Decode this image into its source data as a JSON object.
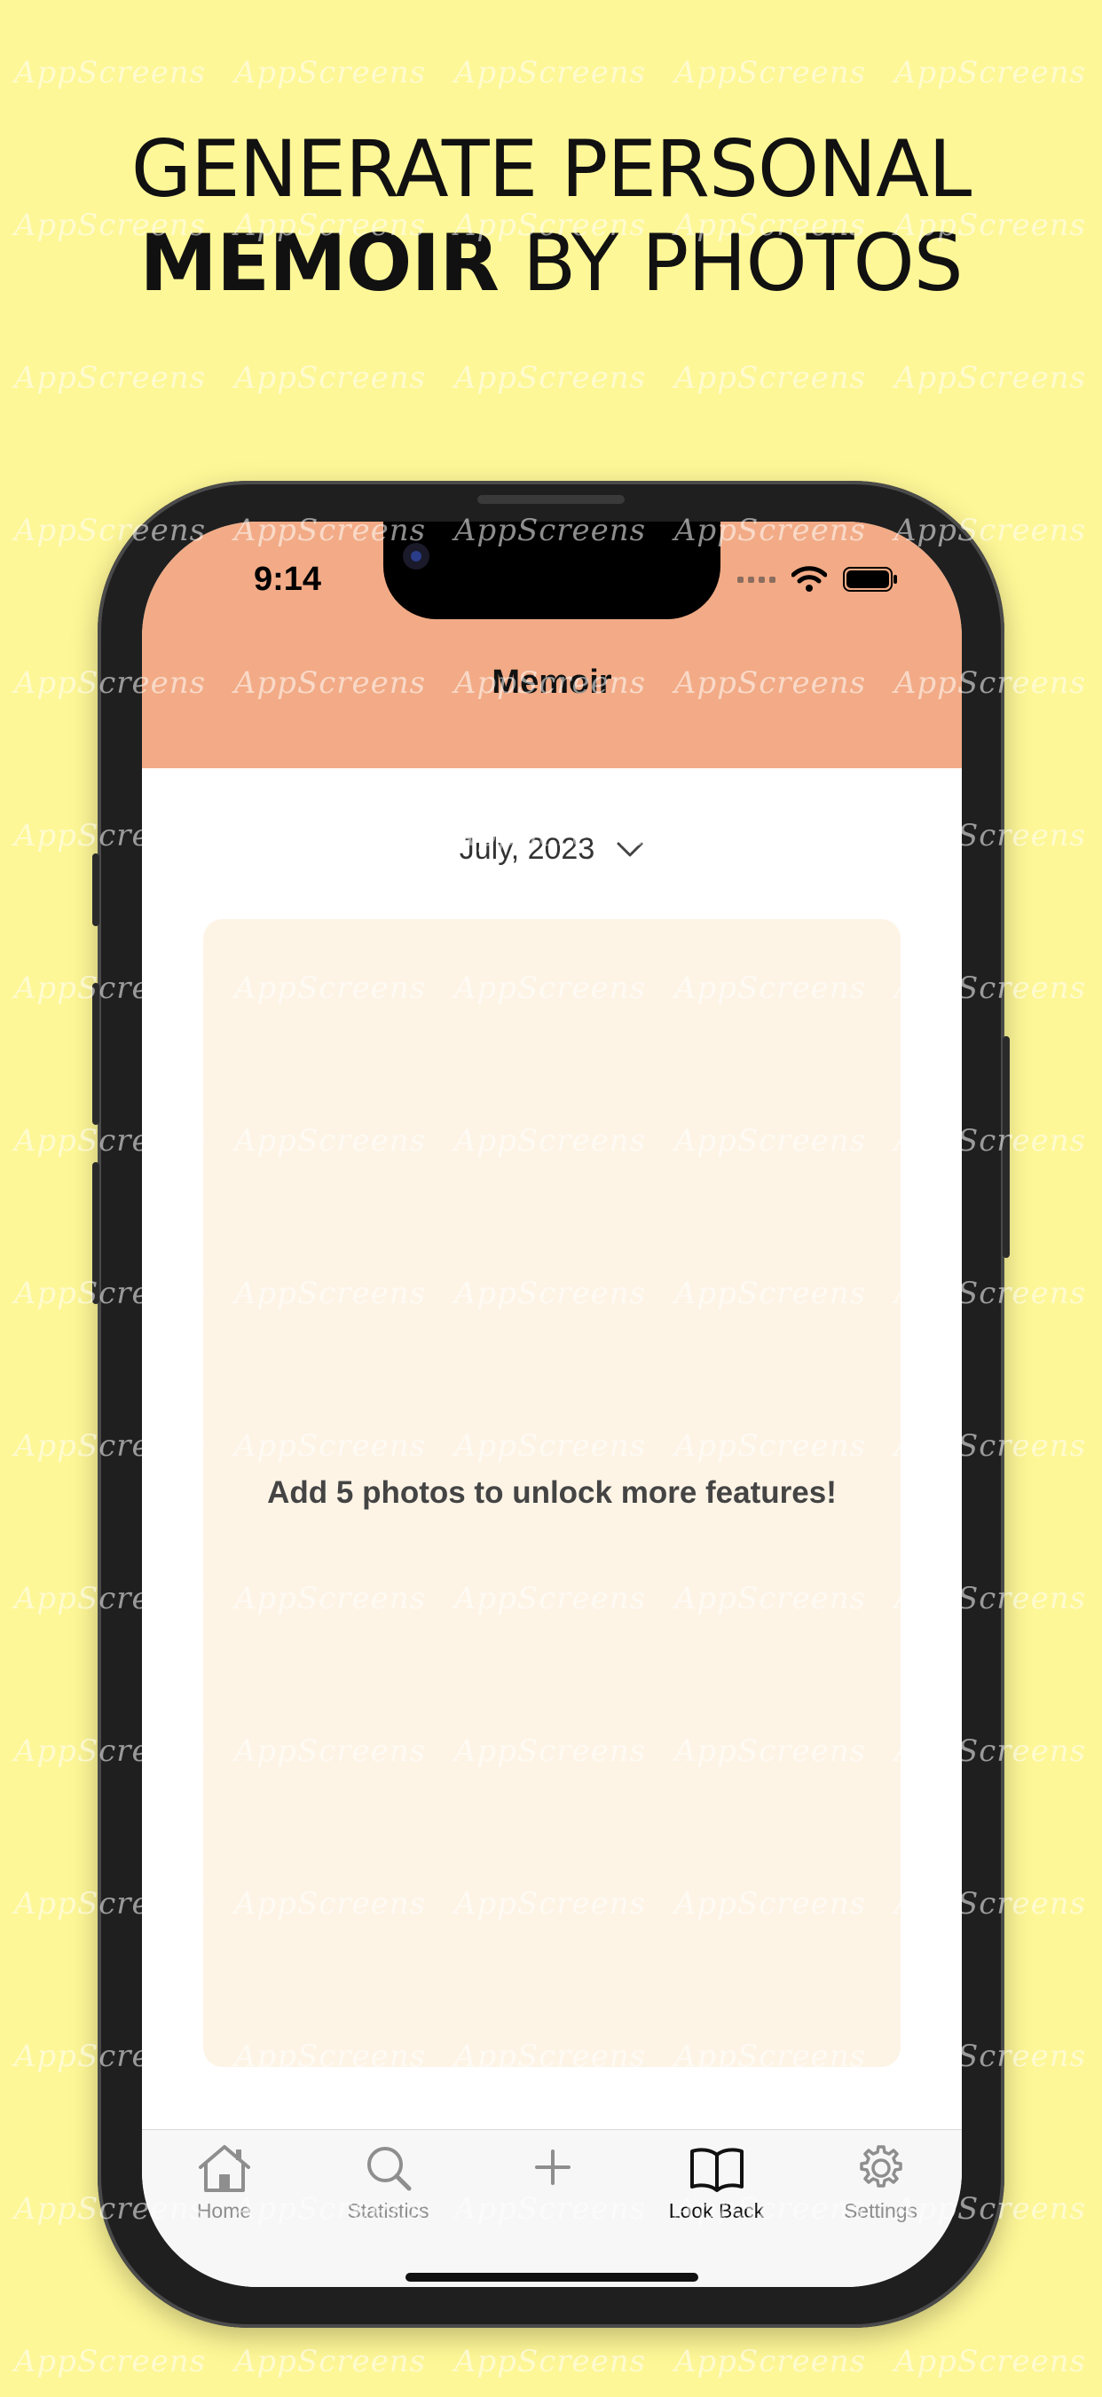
{
  "headline": {
    "line1": "GENERATE PERSONAL",
    "line2_bold": "MEMOIR",
    "line2_rest": " BY PHOTOS"
  },
  "watermark_text": "AppScreens",
  "status_bar": {
    "time": "9:14"
  },
  "nav": {
    "title": "Memoir"
  },
  "date_picker": {
    "label": "July, 2023"
  },
  "card": {
    "message": "Add 5 photos to unlock more features!"
  },
  "tabs": [
    {
      "label": "Home",
      "icon": "house-icon",
      "active": false
    },
    {
      "label": "Statistics",
      "icon": "magnifier-icon",
      "active": false
    },
    {
      "label": "",
      "icon": "plus-icon",
      "active": false
    },
    {
      "label": "Look Back",
      "icon": "open-book-icon",
      "active": true
    },
    {
      "label": "Settings",
      "icon": "gear-icon",
      "active": false
    }
  ],
  "colors": {
    "background": "#fef797",
    "header": "#f2ab86",
    "card": "#fdf4e6",
    "tab_active": "#111111",
    "tab_inactive": "#8e8e8e"
  }
}
